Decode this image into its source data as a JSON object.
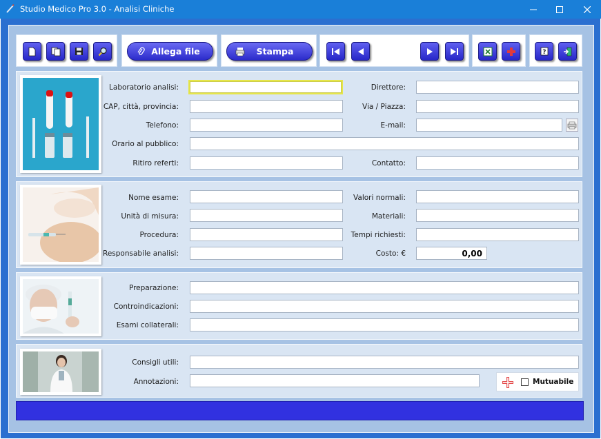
{
  "window": {
    "title": "Studio Medico Pro 3.0 - Analisi Cliniche"
  },
  "toolbar": {
    "attach_label": "Allega file",
    "print_label": "Stampa"
  },
  "lab_section": {
    "laboratorio_label": "Laboratorio analisi:",
    "laboratorio_value": "",
    "cap_label": "CAP, città, provincia:",
    "cap_value": "",
    "telefono_label": "Telefono:",
    "telefono_value": "",
    "orario_label": "Orario al pubblico:",
    "orario_value": "",
    "ritiro_label": "Ritiro referti:",
    "ritiro_value": "",
    "direttore_label": "Direttore:",
    "direttore_value": "",
    "via_label": "Via / Piazza:",
    "via_value": "",
    "email_label": "E-mail:",
    "email_value": "",
    "contatto_label": "Contatto:",
    "contatto_value": ""
  },
  "exam_section": {
    "nome_label": "Nome esame:",
    "nome_value": "",
    "unita_label": "Unità di misura:",
    "unita_value": "",
    "procedura_label": "Procedura:",
    "procedura_value": "",
    "responsabile_label": "Responsabile analisi:",
    "responsabile_value": "",
    "valori_label": "Valori normali:",
    "valori_value": "",
    "materiali_label": "Materiali:",
    "materiali_value": "",
    "tempi_label": "Tempi richiesti:",
    "tempi_value": "",
    "costo_label": "Costo: €",
    "costo_value": "0,00"
  },
  "prep_section": {
    "preparazione_label": "Preparazione:",
    "preparazione_value": "",
    "controindicazioni_label": "Controindicazioni:",
    "controindicazioni_value": "",
    "collaterali_label": "Esami collaterali:",
    "collaterali_value": ""
  },
  "notes_section": {
    "consigli_label": "Consigli utili:",
    "consigli_value": "",
    "annotazioni_label": "Annotazioni:",
    "annotazioni_value": "",
    "mutuabile_label": "Mutuabile",
    "mutuabile_checked": false
  },
  "colors": {
    "titlebar": "#1a7fd8",
    "panel": "#a6c2e4",
    "section": "#d9e5f3",
    "button": "#2b2bcb",
    "statusbar": "#3131e0"
  }
}
